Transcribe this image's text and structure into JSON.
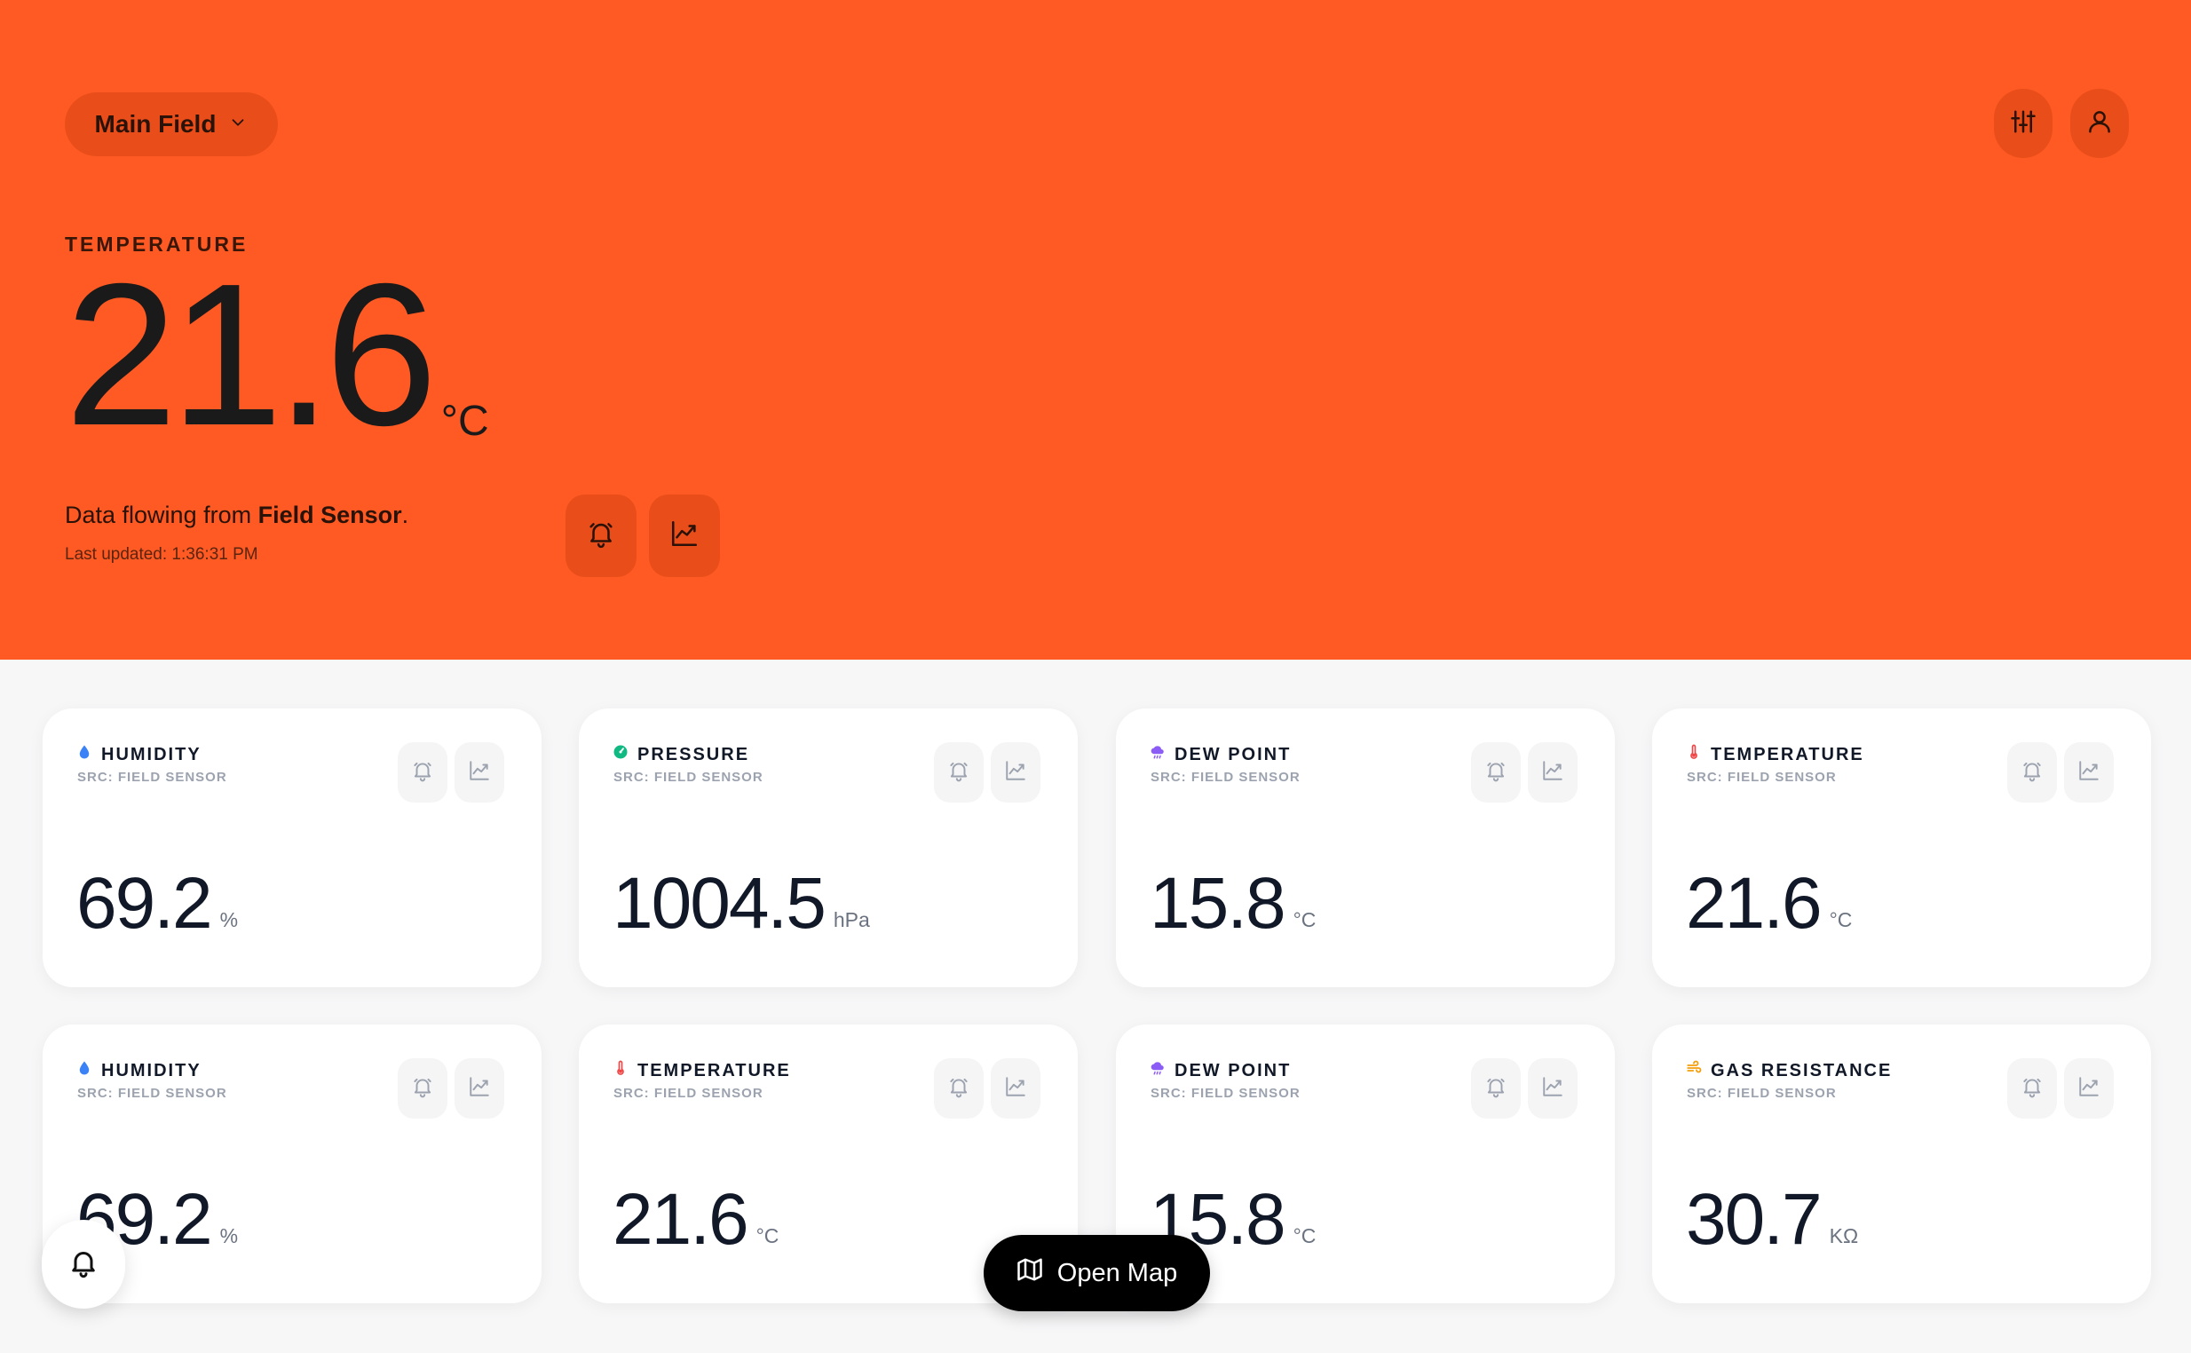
{
  "header": {
    "field_selector": "Main Field",
    "settings_icon": "sliders-icon",
    "profile_icon": "user-icon"
  },
  "hero": {
    "label": "TEMPERATURE",
    "value": "21.6",
    "unit": "°C",
    "desc_prefix": "Data flowing from ",
    "desc_source": "Field Sensor",
    "desc_suffix": ".",
    "last_updated": "Last updated: 1:36:31 PM",
    "color": "#ff5a23"
  },
  "cards": [
    {
      "title": "HUMIDITY",
      "src": "SRC: FIELD SENSOR",
      "value": "69.2",
      "unit": "%",
      "icon": "droplet-icon",
      "icon_color": "#3b82f6"
    },
    {
      "title": "PRESSURE",
      "src": "SRC: FIELD SENSOR",
      "value": "1004.5",
      "unit": "hPa",
      "icon": "gauge-icon",
      "icon_color": "#10b981"
    },
    {
      "title": "DEW POINT",
      "src": "SRC: FIELD SENSOR",
      "value": "15.8",
      "unit": "°C",
      "icon": "cloud-rain-icon",
      "icon_color": "#8b5cf6"
    },
    {
      "title": "TEMPERATURE",
      "src": "SRC: FIELD SENSOR",
      "value": "21.6",
      "unit": "°C",
      "icon": "thermometer-icon",
      "icon_color": "#ef4444"
    },
    {
      "title": "HUMIDITY",
      "src": "SRC: FIELD SENSOR",
      "value": "69.2",
      "unit": "%",
      "icon": "droplet-icon",
      "icon_color": "#3b82f6"
    },
    {
      "title": "TEMPERATURE",
      "src": "SRC: FIELD SENSOR",
      "value": "21.6",
      "unit": "°C",
      "icon": "thermometer-icon",
      "icon_color": "#ef4444"
    },
    {
      "title": "DEW POINT",
      "src": "SRC: FIELD SENSOR",
      "value": "15.8",
      "unit": "°C",
      "icon": "cloud-rain-icon",
      "icon_color": "#8b5cf6"
    },
    {
      "title": "GAS RESISTANCE",
      "src": "SRC: FIELD SENSOR",
      "value": "30.7",
      "unit": "KΩ",
      "icon": "wind-icon",
      "icon_color": "#f59e0b"
    }
  ],
  "map_button": {
    "label": "Open Map",
    "icon": "map-icon"
  },
  "notification_fab": {
    "icon": "bell-icon"
  }
}
